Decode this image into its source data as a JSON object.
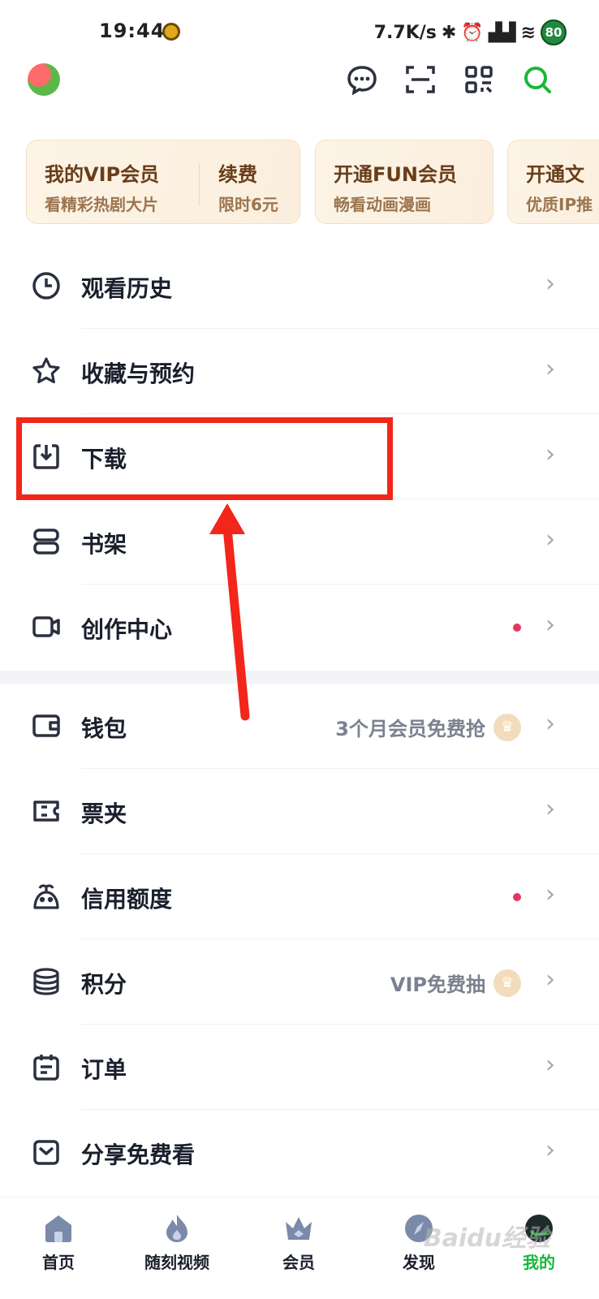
{
  "status_bar": {
    "time": "19:44",
    "network_speed": "7.7K/s",
    "battery": "80",
    "icons": [
      "app-notification-icon",
      "bluetooth-icon",
      "alarm-icon",
      "hd-signal-icon",
      "hd-signal-icon",
      "wifi-icon",
      "battery-icon"
    ]
  },
  "toolbar": {
    "avatar_icon": "avatar",
    "icons": [
      "message-icon",
      "scan-icon",
      "qr-code-icon",
      "search-icon"
    ],
    "accent_color": "#17b83a"
  },
  "vip_cards": [
    {
      "title": "我的VIP会员",
      "subtitle": "看精彩热剧大片"
    },
    {
      "title": "续费",
      "subtitle": "限时6元"
    },
    {
      "title": "开通FUN会员",
      "subtitle": "畅看动画漫画"
    },
    {
      "title": "开通文",
      "subtitle": "优质IP推"
    }
  ],
  "menu": [
    {
      "label": "观看历史",
      "icon": "clock-icon"
    },
    {
      "label": "收藏与预约",
      "icon": "star-icon"
    },
    {
      "label": "下载",
      "icon": "download-icon"
    },
    {
      "label": "书架",
      "icon": "bookshelf-icon"
    },
    {
      "label": "创作中心",
      "icon": "video-camera-icon",
      "dot": true
    }
  ],
  "menu2": [
    {
      "label": "钱包",
      "icon": "wallet-icon",
      "promo": "3个月会员免费抢"
    },
    {
      "label": "票夹",
      "icon": "ticket-icon"
    },
    {
      "label": "信用额度",
      "icon": "credit-icon",
      "dot": true
    },
    {
      "label": "积分",
      "icon": "coins-icon",
      "promo": "VIP免费抽"
    },
    {
      "label": "订单",
      "icon": "order-icon"
    },
    {
      "label": "分享免费看",
      "icon": "share-icon"
    }
  ],
  "chevron": "›",
  "annotation": {
    "box_color": "#f2261a"
  },
  "bottom_nav": [
    {
      "label": "首页",
      "icon": "home-icon"
    },
    {
      "label": "随刻视频",
      "icon": "flame-icon"
    },
    {
      "label": "会员",
      "icon": "crown-icon"
    },
    {
      "label": "发现",
      "icon": "compass-icon"
    },
    {
      "label": "我的",
      "icon": "profile-icon",
      "active": true
    }
  ],
  "watermark": "Baidu经验"
}
